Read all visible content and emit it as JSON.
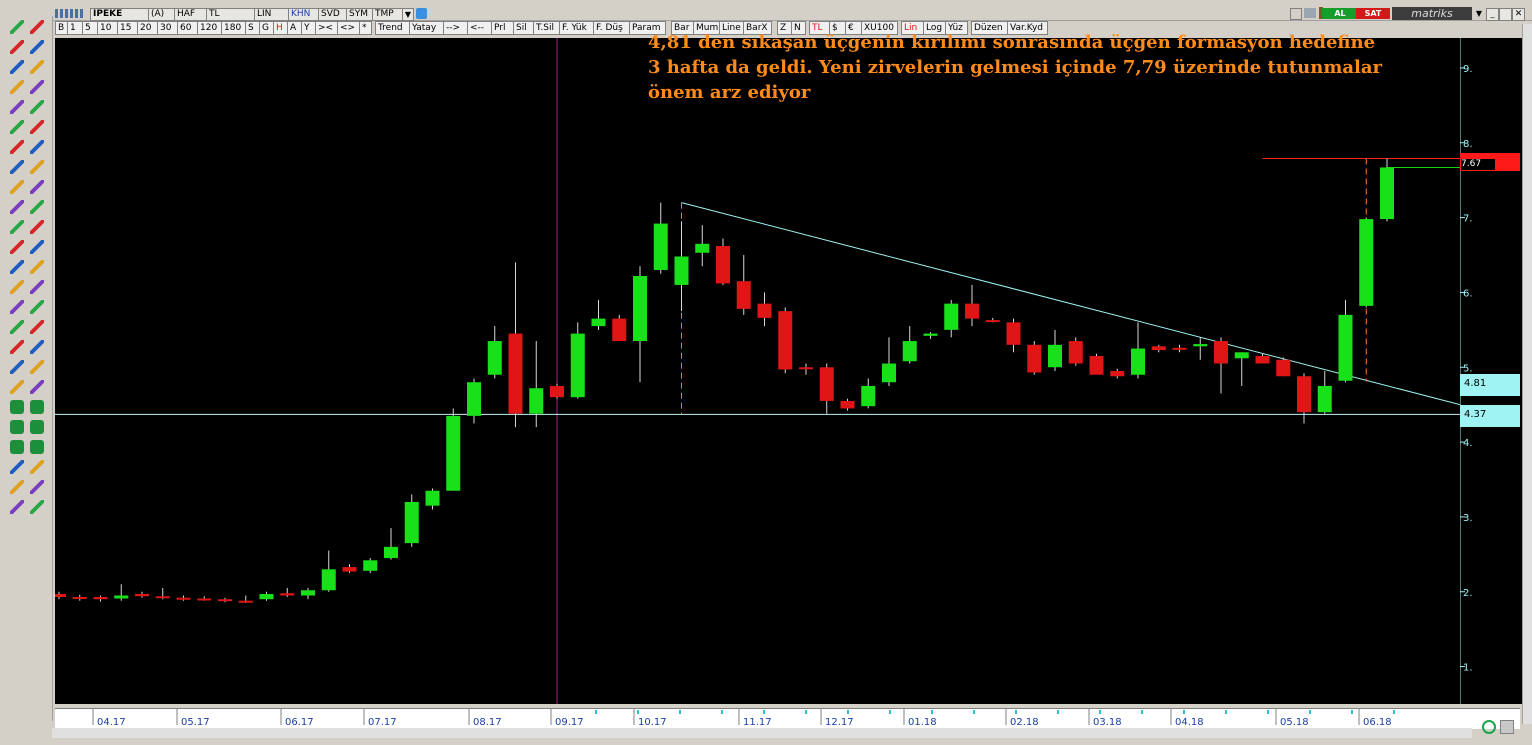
{
  "window": {
    "symbol": "IPEKE",
    "chips": [
      "(A)",
      "HAF",
      "TL",
      "LIN",
      "KHN",
      "SVD",
      "SYM",
      "TMP"
    ],
    "brand": "matriks",
    "buy_label": "AL",
    "sell_label": "SAT"
  },
  "toolbar2": {
    "items": [
      "B",
      "1",
      "5",
      "10",
      "15",
      "20",
      "30",
      "60",
      "120",
      "180",
      "S",
      "G",
      "H",
      "A",
      "Y",
      "><",
      "<>",
      "*",
      "Trend",
      "Yatay",
      "-->",
      "<--",
      "Prl",
      "Sil",
      "T.Sil",
      "F. Yük",
      "F. Düş",
      "Param",
      "Bar",
      "Mum",
      "Line",
      "BarX",
      "Z",
      "N",
      "TL",
      "$",
      "€",
      "XU100",
      "Lin",
      "Log",
      "Yüz",
      "Düzen",
      "Var.Kyd"
    ]
  },
  "annotation": {
    "text": "4,81 den sıkaşan üçgenin kırılımı sonrasında üçgen formasyon hedefine 3 hafta da geldi. Yeni zirvelerin gelmesi içinde 7,79 üzerinde tutunmalar önem arz ediyor"
  },
  "price_labels": {
    "last": "7.67",
    "res": "4.81",
    "sup": "4.37"
  },
  "chart_data": {
    "type": "candlestick",
    "y_ticks": [
      "9.",
      "8.",
      "7.",
      "6.",
      "5.",
      "4.",
      "3.",
      "2.",
      "1."
    ],
    "ylim": [
      0.5,
      9.4
    ],
    "x_labels": [
      "04.17",
      "05.17",
      "06.17",
      "07.17",
      "08.17",
      "09.17",
      "10.17",
      "11.17",
      "12.17",
      "01.18",
      "02.18",
      "03.18",
      "04.18",
      "05.18",
      "06.18"
    ],
    "candles": [
      {
        "o": 1.97,
        "h": 2.0,
        "l": 1.9,
        "c": 1.93
      },
      {
        "o": 1.93,
        "h": 1.96,
        "l": 1.88,
        "c": 1.92
      },
      {
        "o": 1.93,
        "h": 1.95,
        "l": 1.87,
        "c": 1.9
      },
      {
        "o": 1.91,
        "h": 2.1,
        "l": 1.88,
        "c": 1.95
      },
      {
        "o": 1.97,
        "h": 2.0,
        "l": 1.92,
        "c": 1.94
      },
      {
        "o": 1.94,
        "h": 2.05,
        "l": 1.9,
        "c": 1.92
      },
      {
        "o": 1.92,
        "h": 1.95,
        "l": 1.88,
        "c": 1.9
      },
      {
        "o": 1.91,
        "h": 1.94,
        "l": 1.88,
        "c": 1.9
      },
      {
        "o": 1.9,
        "h": 1.92,
        "l": 1.86,
        "c": 1.88
      },
      {
        "o": 1.88,
        "h": 1.95,
        "l": 1.85,
        "c": 1.86
      },
      {
        "o": 1.9,
        "h": 2.0,
        "l": 1.88,
        "c": 1.97
      },
      {
        "o": 1.98,
        "h": 2.05,
        "l": 1.93,
        "c": 1.95
      },
      {
        "o": 1.95,
        "h": 2.05,
        "l": 1.9,
        "c": 2.02
      },
      {
        "o": 2.02,
        "h": 2.55,
        "l": 2.0,
        "c": 2.3
      },
      {
        "o": 2.33,
        "h": 2.37,
        "l": 2.25,
        "c": 2.27
      },
      {
        "o": 2.28,
        "h": 2.45,
        "l": 2.25,
        "c": 2.42
      },
      {
        "o": 2.45,
        "h": 2.85,
        "l": 2.43,
        "c": 2.6
      },
      {
        "o": 2.65,
        "h": 3.3,
        "l": 2.6,
        "c": 3.2
      },
      {
        "o": 3.15,
        "h": 3.38,
        "l": 3.1,
        "c": 3.35
      },
      {
        "o": 3.35,
        "h": 4.45,
        "l": 3.35,
        "c": 4.35
      },
      {
        "o": 4.35,
        "h": 4.85,
        "l": 4.25,
        "c": 4.8
      },
      {
        "o": 4.9,
        "h": 5.55,
        "l": 4.85,
        "c": 5.35
      },
      {
        "o": 5.45,
        "h": 6.4,
        "l": 4.2,
        "c": 4.38
      },
      {
        "o": 4.38,
        "h": 5.35,
        "l": 4.2,
        "c": 4.72
      },
      {
        "o": 4.75,
        "h": 4.78,
        "l": 4.58,
        "c": 4.6
      },
      {
        "o": 4.6,
        "h": 5.6,
        "l": 4.58,
        "c": 5.45
      },
      {
        "o": 5.55,
        "h": 5.9,
        "l": 5.5,
        "c": 5.65
      },
      {
        "o": 5.65,
        "h": 5.7,
        "l": 5.4,
        "c": 5.35
      },
      {
        "o": 5.35,
        "h": 6.35,
        "l": 4.8,
        "c": 6.22
      },
      {
        "o": 6.3,
        "h": 7.2,
        "l": 6.25,
        "c": 6.92
      },
      {
        "o": 6.1,
        "h": 6.95,
        "l": 5.75,
        "c": 6.48
      },
      {
        "o": 6.53,
        "h": 6.9,
        "l": 6.35,
        "c": 6.65
      },
      {
        "o": 6.62,
        "h": 6.72,
        "l": 6.1,
        "c": 6.12
      },
      {
        "o": 6.15,
        "h": 6.5,
        "l": 5.7,
        "c": 5.78
      },
      {
        "o": 5.85,
        "h": 6.0,
        "l": 5.55,
        "c": 5.66
      },
      {
        "o": 5.75,
        "h": 5.8,
        "l": 4.92,
        "c": 4.97
      },
      {
        "o": 5.0,
        "h": 5.05,
        "l": 4.9,
        "c": 4.98
      },
      {
        "o": 5.0,
        "h": 5.05,
        "l": 4.38,
        "c": 4.55
      },
      {
        "o": 4.55,
        "h": 4.58,
        "l": 4.42,
        "c": 4.45
      },
      {
        "o": 4.48,
        "h": 4.85,
        "l": 4.45,
        "c": 4.75
      },
      {
        "o": 4.8,
        "h": 5.4,
        "l": 4.75,
        "c": 5.05
      },
      {
        "o": 5.08,
        "h": 5.55,
        "l": 5.05,
        "c": 5.35
      },
      {
        "o": 5.42,
        "h": 5.47,
        "l": 5.38,
        "c": 5.45
      },
      {
        "o": 5.5,
        "h": 5.9,
        "l": 5.4,
        "c": 5.85
      },
      {
        "o": 5.85,
        "h": 6.1,
        "l": 5.55,
        "c": 5.65
      },
      {
        "o": 5.63,
        "h": 5.66,
        "l": 5.6,
        "c": 5.62
      },
      {
        "o": 5.6,
        "h": 5.65,
        "l": 5.2,
        "c": 5.3
      },
      {
        "o": 5.3,
        "h": 5.35,
        "l": 4.9,
        "c": 4.93
      },
      {
        "o": 5.0,
        "h": 5.5,
        "l": 4.95,
        "c": 5.3
      },
      {
        "o": 5.35,
        "h": 5.4,
        "l": 5.02,
        "c": 5.05
      },
      {
        "o": 5.15,
        "h": 5.18,
        "l": 4.92,
        "c": 4.9
      },
      {
        "o": 4.95,
        "h": 4.98,
        "l": 4.85,
        "c": 4.88
      },
      {
        "o": 4.9,
        "h": 5.6,
        "l": 4.85,
        "c": 5.25
      },
      {
        "o": 5.28,
        "h": 5.3,
        "l": 5.2,
        "c": 5.23
      },
      {
        "o": 5.26,
        "h": 5.3,
        "l": 5.2,
        "c": 5.24
      },
      {
        "o": 5.28,
        "h": 5.4,
        "l": 5.1,
        "c": 5.31
      },
      {
        "o": 5.35,
        "h": 5.4,
        "l": 4.65,
        "c": 5.05
      },
      {
        "o": 5.12,
        "h": 5.2,
        "l": 4.75,
        "c": 5.2
      },
      {
        "o": 5.15,
        "h": 5.18,
        "l": 5.05,
        "c": 5.05
      },
      {
        "o": 5.1,
        "h": 5.13,
        "l": 4.88,
        "c": 4.88
      },
      {
        "o": 4.88,
        "h": 4.92,
        "l": 4.25,
        "c": 4.4
      },
      {
        "o": 4.4,
        "h": 4.95,
        "l": 4.38,
        "c": 4.75
      },
      {
        "o": 4.82,
        "h": 5.9,
        "l": 4.8,
        "c": 5.7
      },
      {
        "o": 5.82,
        "h": 7.0,
        "l": 5.8,
        "c": 6.98
      },
      {
        "o": 6.98,
        "h": 7.79,
        "l": 6.95,
        "c": 7.67
      }
    ],
    "trendline": {
      "from_candle": 30,
      "from_value": 7.2,
      "to_value": 4.5
    },
    "support_level": 4.37,
    "resistance_level": 7.79,
    "cursor_candle": 24,
    "vertical_marks": [
      30,
      63
    ]
  }
}
